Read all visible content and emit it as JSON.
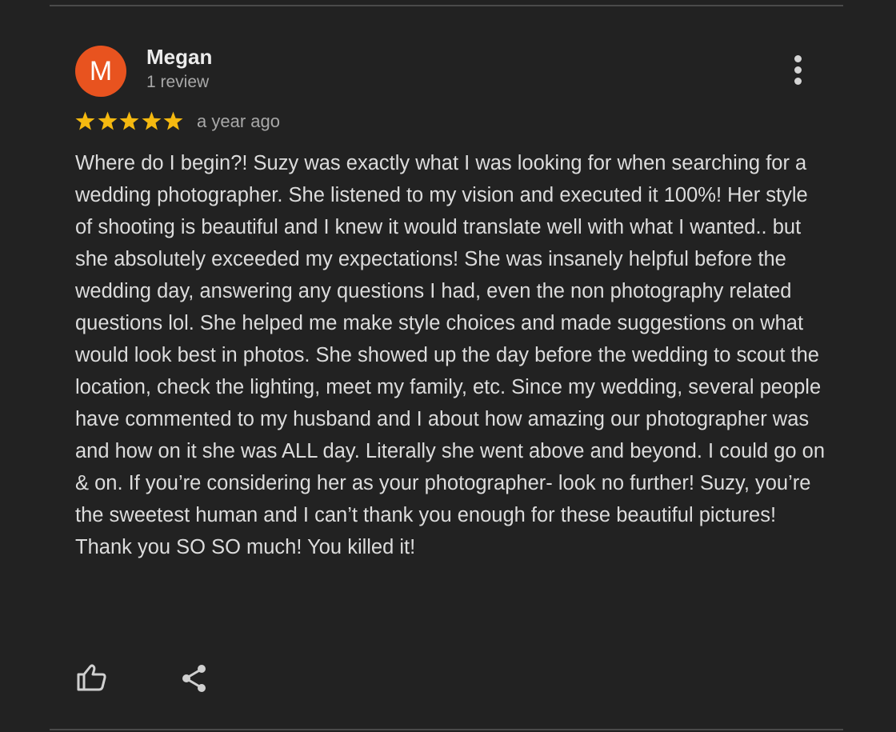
{
  "review": {
    "author": {
      "initial": "M",
      "name": "Megan",
      "meta": "1 review",
      "avatar_color": "#e8531f"
    },
    "rating": 5,
    "rating_max": 5,
    "star_color": "#f5b910",
    "date": "a year ago",
    "text": "Where do I begin?! Suzy was exactly what I was looking for when searching for a wedding photographer. She listened to my vision and executed it 100%! Her style of shooting is beautiful and I knew it would translate well with what I wanted.. but she absolutely exceeded my expectations! She was insanely helpful before the wedding day, answering any questions I had, even the non photography related questions lol. She helped me make style choices and made suggestions on what would look best in photos. She showed up the day before the wedding to scout the location, check the lighting, meet my family, etc. Since my wedding, several people have commented to my husband and I about how amazing our photographer was and how on it she was ALL day. Literally she went above and beyond. I could go on & on. If you’re considering her as your photographer- look no further! Suzy, you’re the sweetest human and I can’t thank you enough for these beautiful pictures! Thank you SO SO much! You killed it!",
    "menu_icon": "more-vertical-icon",
    "actions": [
      {
        "icon": "thumbs-up-icon"
      },
      {
        "icon": "share-icon"
      }
    ]
  }
}
